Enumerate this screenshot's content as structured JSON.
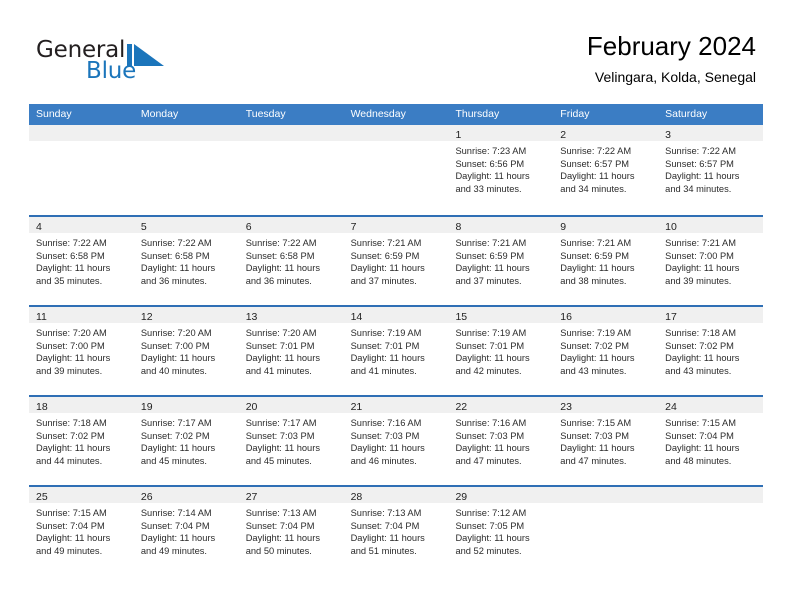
{
  "brand": {
    "name_part1": "General",
    "name_part2": "Blue",
    "mark": "triangle-flag-icon",
    "color_dark": "#231f20",
    "color_blue": "#1b75bb"
  },
  "header": {
    "title": "February 2024",
    "subtitle": "Velingara, Kolda, Senegal"
  },
  "theme": {
    "header_blue": "#3b7dc4",
    "row_divider_blue": "#2f6fb5",
    "daynum_strip": "#f0f0f0"
  },
  "weekdays": [
    "Sunday",
    "Monday",
    "Tuesday",
    "Wednesday",
    "Thursday",
    "Friday",
    "Saturday"
  ],
  "weeks": [
    [
      {
        "day": "",
        "lines": []
      },
      {
        "day": "",
        "lines": []
      },
      {
        "day": "",
        "lines": []
      },
      {
        "day": "",
        "lines": []
      },
      {
        "day": "1",
        "lines": [
          "Sunrise: 7:23 AM",
          "Sunset: 6:56 PM",
          "Daylight: 11 hours",
          "and 33 minutes."
        ]
      },
      {
        "day": "2",
        "lines": [
          "Sunrise: 7:22 AM",
          "Sunset: 6:57 PM",
          "Daylight: 11 hours",
          "and 34 minutes."
        ]
      },
      {
        "day": "3",
        "lines": [
          "Sunrise: 7:22 AM",
          "Sunset: 6:57 PM",
          "Daylight: 11 hours",
          "and 34 minutes."
        ]
      }
    ],
    [
      {
        "day": "4",
        "lines": [
          "Sunrise: 7:22 AM",
          "Sunset: 6:58 PM",
          "Daylight: 11 hours",
          "and 35 minutes."
        ]
      },
      {
        "day": "5",
        "lines": [
          "Sunrise: 7:22 AM",
          "Sunset: 6:58 PM",
          "Daylight: 11 hours",
          "and 36 minutes."
        ]
      },
      {
        "day": "6",
        "lines": [
          "Sunrise: 7:22 AM",
          "Sunset: 6:58 PM",
          "Daylight: 11 hours",
          "and 36 minutes."
        ]
      },
      {
        "day": "7",
        "lines": [
          "Sunrise: 7:21 AM",
          "Sunset: 6:59 PM",
          "Daylight: 11 hours",
          "and 37 minutes."
        ]
      },
      {
        "day": "8",
        "lines": [
          "Sunrise: 7:21 AM",
          "Sunset: 6:59 PM",
          "Daylight: 11 hours",
          "and 37 minutes."
        ]
      },
      {
        "day": "9",
        "lines": [
          "Sunrise: 7:21 AM",
          "Sunset: 6:59 PM",
          "Daylight: 11 hours",
          "and 38 minutes."
        ]
      },
      {
        "day": "10",
        "lines": [
          "Sunrise: 7:21 AM",
          "Sunset: 7:00 PM",
          "Daylight: 11 hours",
          "and 39 minutes."
        ]
      }
    ],
    [
      {
        "day": "11",
        "lines": [
          "Sunrise: 7:20 AM",
          "Sunset: 7:00 PM",
          "Daylight: 11 hours",
          "and 39 minutes."
        ]
      },
      {
        "day": "12",
        "lines": [
          "Sunrise: 7:20 AM",
          "Sunset: 7:00 PM",
          "Daylight: 11 hours",
          "and 40 minutes."
        ]
      },
      {
        "day": "13",
        "lines": [
          "Sunrise: 7:20 AM",
          "Sunset: 7:01 PM",
          "Daylight: 11 hours",
          "and 41 minutes."
        ]
      },
      {
        "day": "14",
        "lines": [
          "Sunrise: 7:19 AM",
          "Sunset: 7:01 PM",
          "Daylight: 11 hours",
          "and 41 minutes."
        ]
      },
      {
        "day": "15",
        "lines": [
          "Sunrise: 7:19 AM",
          "Sunset: 7:01 PM",
          "Daylight: 11 hours",
          "and 42 minutes."
        ]
      },
      {
        "day": "16",
        "lines": [
          "Sunrise: 7:19 AM",
          "Sunset: 7:02 PM",
          "Daylight: 11 hours",
          "and 43 minutes."
        ]
      },
      {
        "day": "17",
        "lines": [
          "Sunrise: 7:18 AM",
          "Sunset: 7:02 PM",
          "Daylight: 11 hours",
          "and 43 minutes."
        ]
      }
    ],
    [
      {
        "day": "18",
        "lines": [
          "Sunrise: 7:18 AM",
          "Sunset: 7:02 PM",
          "Daylight: 11 hours",
          "and 44 minutes."
        ]
      },
      {
        "day": "19",
        "lines": [
          "Sunrise: 7:17 AM",
          "Sunset: 7:02 PM",
          "Daylight: 11 hours",
          "and 45 minutes."
        ]
      },
      {
        "day": "20",
        "lines": [
          "Sunrise: 7:17 AM",
          "Sunset: 7:03 PM",
          "Daylight: 11 hours",
          "and 45 minutes."
        ]
      },
      {
        "day": "21",
        "lines": [
          "Sunrise: 7:16 AM",
          "Sunset: 7:03 PM",
          "Daylight: 11 hours",
          "and 46 minutes."
        ]
      },
      {
        "day": "22",
        "lines": [
          "Sunrise: 7:16 AM",
          "Sunset: 7:03 PM",
          "Daylight: 11 hours",
          "and 47 minutes."
        ]
      },
      {
        "day": "23",
        "lines": [
          "Sunrise: 7:15 AM",
          "Sunset: 7:03 PM",
          "Daylight: 11 hours",
          "and 47 minutes."
        ]
      },
      {
        "day": "24",
        "lines": [
          "Sunrise: 7:15 AM",
          "Sunset: 7:04 PM",
          "Daylight: 11 hours",
          "and 48 minutes."
        ]
      }
    ],
    [
      {
        "day": "25",
        "lines": [
          "Sunrise: 7:15 AM",
          "Sunset: 7:04 PM",
          "Daylight: 11 hours",
          "and 49 minutes."
        ]
      },
      {
        "day": "26",
        "lines": [
          "Sunrise: 7:14 AM",
          "Sunset: 7:04 PM",
          "Daylight: 11 hours",
          "and 49 minutes."
        ]
      },
      {
        "day": "27",
        "lines": [
          "Sunrise: 7:13 AM",
          "Sunset: 7:04 PM",
          "Daylight: 11 hours",
          "and 50 minutes."
        ]
      },
      {
        "day": "28",
        "lines": [
          "Sunrise: 7:13 AM",
          "Sunset: 7:04 PM",
          "Daylight: 11 hours",
          "and 51 minutes."
        ]
      },
      {
        "day": "29",
        "lines": [
          "Sunrise: 7:12 AM",
          "Sunset: 7:05 PM",
          "Daylight: 11 hours",
          "and 52 minutes."
        ]
      },
      {
        "day": "",
        "lines": []
      },
      {
        "day": "",
        "lines": []
      }
    ]
  ]
}
